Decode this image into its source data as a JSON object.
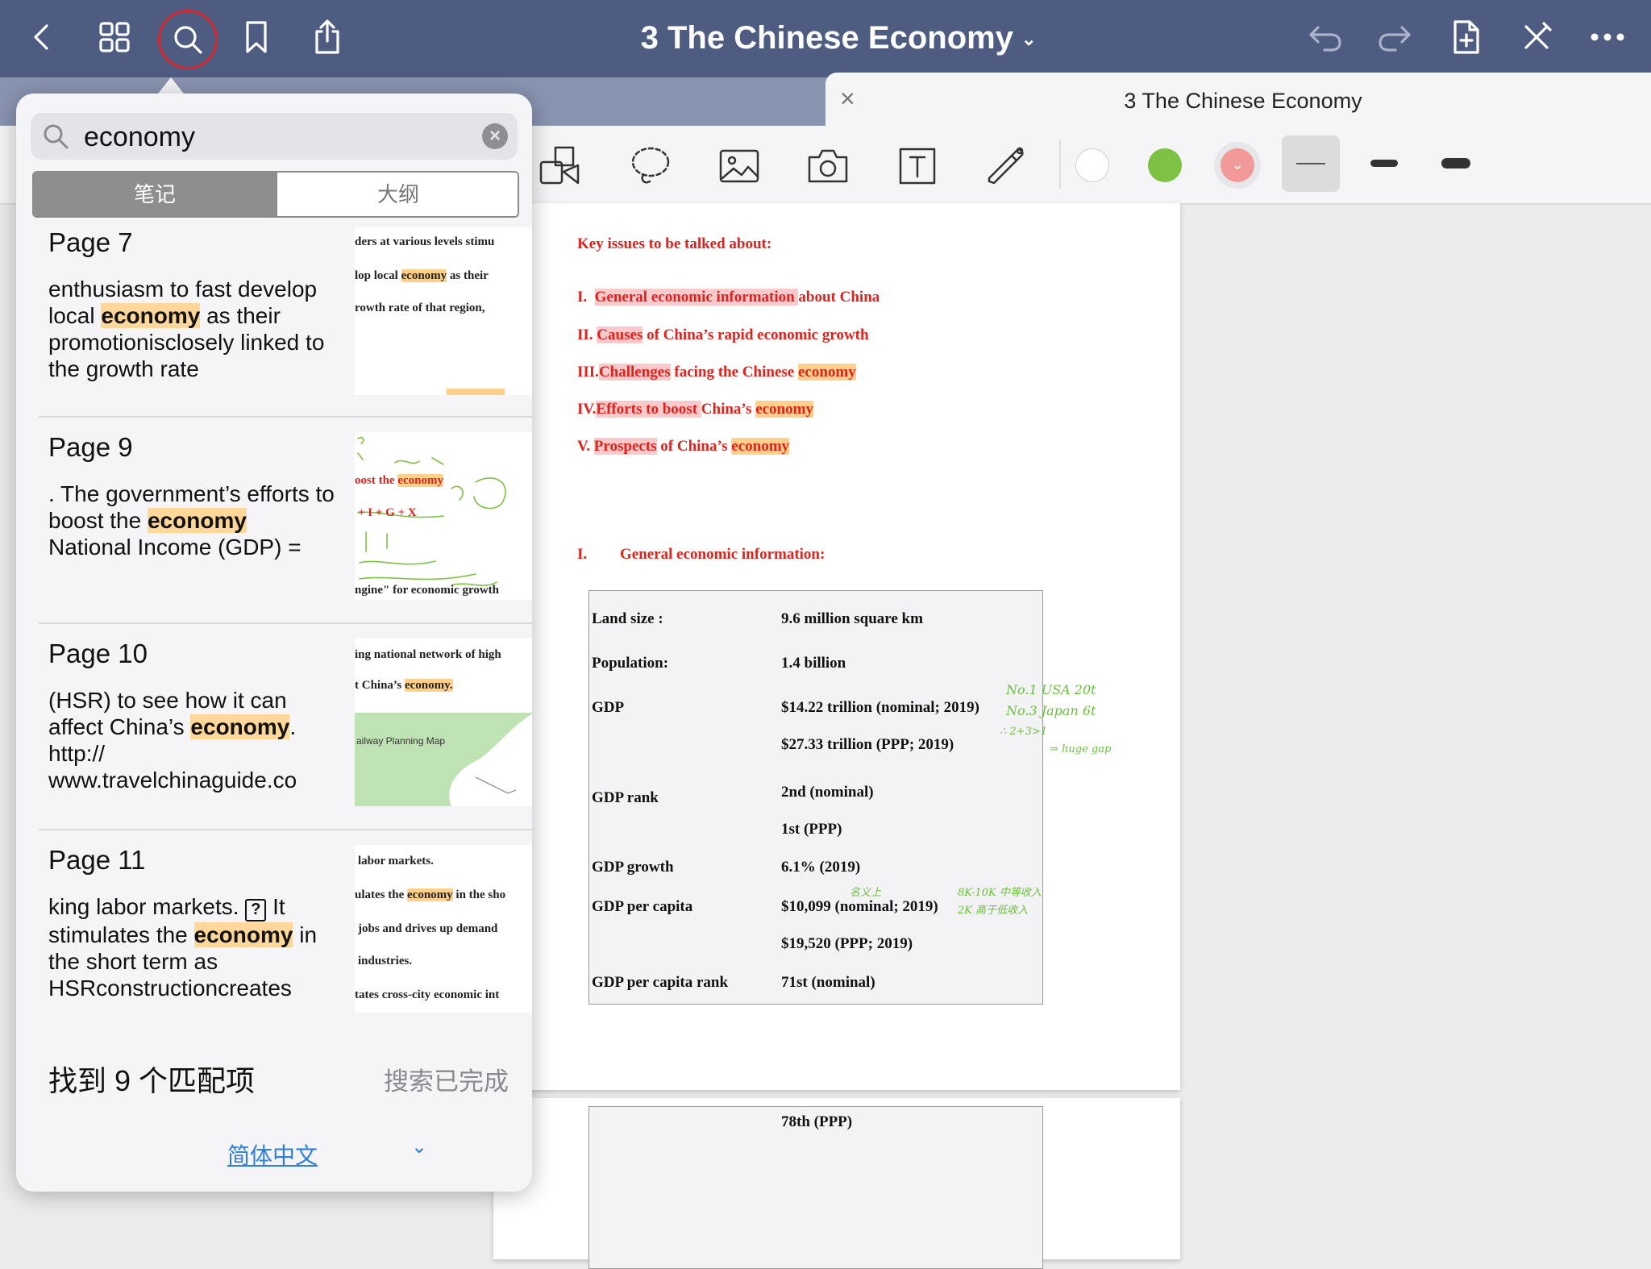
{
  "topbar": {
    "title": "3 The Chinese Economy",
    "title_chevron": "⌄"
  },
  "tab": {
    "title": "3 The Chinese Economy",
    "close": "×"
  },
  "document": {
    "heading": "Key issues to be talked about:",
    "issues": [
      {
        "num": "I.",
        "hl": "General economic information ",
        "rest": "about China",
        "kw": ""
      },
      {
        "num": "II.",
        "hl": "Causes",
        "rest": " of China’s rapid economic growth",
        "kw": ""
      },
      {
        "num": "III.",
        "hl": "Challenges",
        "rest": " facing the Chinese ",
        "kw": "economy"
      },
      {
        "num": "IV.",
        "hl": "Efforts to boost ",
        "rest": "China’s ",
        "kw": "economy"
      },
      {
        "num": "V.",
        "hl": "Prospects",
        "rest": " of China’s ",
        "kw": "economy"
      }
    ],
    "section_num": "I.",
    "section_title": "General economic information:",
    "table": [
      {
        "label": "Land size :",
        "value": "9.6 million square km"
      },
      {
        "label": "Population:",
        "value": "1.4 billion"
      },
      {
        "label": "GDP",
        "value": "$14.22 trillion (nominal; 2019)"
      },
      {
        "label": "",
        "value": "$27.33 trillion (PPP; 2019)"
      },
      {
        "label": "GDP rank",
        "value": "2nd (nominal)"
      },
      {
        "label": "",
        "value": "1st (PPP)"
      },
      {
        "label": "GDP growth",
        "value": "6.1% (2019)"
      },
      {
        "label": "GDP per capita",
        "value": "$10,099 (nominal; 2019)"
      },
      {
        "label": "",
        "value": "$19,520 (PPP; 2019)"
      },
      {
        "label": "GDP per capita rank",
        "value": "71st (nominal)"
      }
    ],
    "page2_text": "78th (PPP)",
    "handwriting": [
      "No.1 USA 20t",
      "No.3 Japan 6t",
      "∴ 2+3>1",
      "⇒ huge gap",
      "名义上",
      "8K-10K 中等收入",
      "2K 高于低收入"
    ]
  },
  "search": {
    "query": "economy",
    "seg_notes": "笔记",
    "seg_outline": "大纲",
    "results": [
      {
        "page": "Page 7",
        "snippet_before": "enthusiasm to fast develop local ",
        "snippet_kw": "economy",
        "snippet_after": " as their promotionisclosely linked to the growth rate",
        "thumb_lines": [
          {
            "pre": "ders  at  various  levels  stimu",
            "kw": "",
            "post": ""
          },
          {
            "pre": "lop  local  ",
            "kw": "economy",
            "post": "  as  their"
          },
          {
            "pre": "rowth  rate  of  that  region,",
            "kw": "",
            "post": ""
          }
        ]
      },
      {
        "page": "Page 9",
        "snippet_before": ". The government’s efforts to boost the ",
        "snippet_kw": "economy",
        "snippet_after": " National Income (GDP) =",
        "thumb_lines": [
          {
            "pre": "oost the ",
            "kw": "economy",
            "post": ""
          },
          {
            "pre": "+ I + G + X",
            "kw": "",
            "post": ""
          },
          {
            "pre": "ngine\" for economic growth",
            "kw": "",
            "post": ""
          }
        ]
      },
      {
        "page": "Page 10",
        "snippet_before": " (HSR) to see how it can affect China’s ",
        "snippet_kw": "economy",
        "snippet_after": ". http:// www.travelchinaguide.co",
        "thumb_lines": [
          {
            "pre": "ing national network of high",
            "kw": "",
            "post": ""
          },
          {
            "pre": "t China’s ",
            "kw": "economy.",
            "post": ""
          }
        ],
        "map_label": "ailway Planning Map"
      },
      {
        "page": "Page 11",
        "snippet_before": "king labor markets. ",
        "snippet_q": "?",
        "snippet_mid": " It stimulates the ",
        "snippet_kw": "economy",
        "snippet_after": " in the short term as HSRconstructioncreates",
        "thumb_lines": [
          {
            "pre": "labor markets.",
            "kw": "",
            "post": ""
          },
          {
            "pre": "ulates the ",
            "kw": "economy",
            "post": " in the sho"
          },
          {
            "pre": "jobs and drives up demand",
            "kw": "",
            "post": ""
          },
          {
            "pre": "industries.",
            "kw": "",
            "post": ""
          },
          {
            "pre": "tates cross-city economic int",
            "kw": "",
            "post": ""
          }
        ]
      }
    ],
    "found_count": "找到 9 个匹配项",
    "status": "搜索已完成",
    "language": "简体中文",
    "language_chevron": "⌄"
  },
  "colors": {
    "topbar": "#4d5c80",
    "tabrow": "#8994b1",
    "green_pen": "#7dc242",
    "pink_pen": "#f29a9a",
    "highlight_orange": "#ffd08a",
    "doc_red": "#e0211c",
    "search_ring": "#d9262c",
    "link_blue": "#2f7fd8"
  }
}
